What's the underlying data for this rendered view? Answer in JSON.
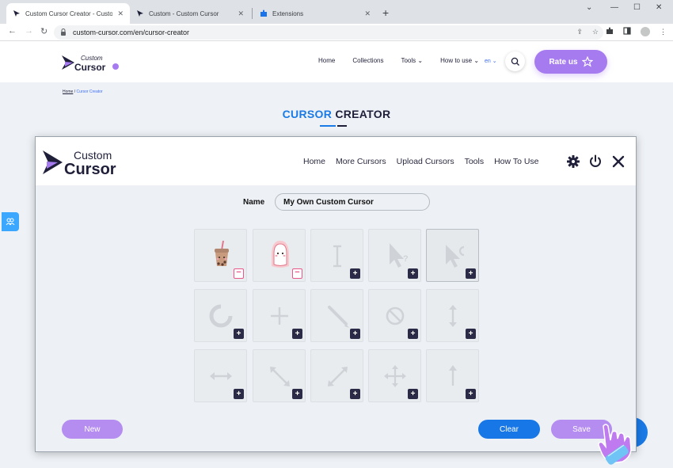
{
  "browser": {
    "tabs": [
      {
        "title": "Custom Cursor Creator - Custom",
        "active": true
      },
      {
        "title": "Custom - Custom Cursor",
        "active": false
      },
      {
        "title": "Extensions",
        "active": false
      }
    ],
    "url": "custom-cursor.com/en/cursor-creator",
    "new_tab": "+",
    "window_controls": [
      "⌄",
      "—",
      "☐",
      "✕"
    ]
  },
  "site": {
    "logo": {
      "line1": "Custom",
      "line2": "Cursor"
    },
    "nav": [
      "Home",
      "Collections",
      "Tools",
      "How to use"
    ],
    "language": "en",
    "rate_button": "Rate us",
    "breadcrumb": {
      "home": "Home",
      "separator": "/",
      "current": "Cursor Creator"
    },
    "title": {
      "accent": "CURSOR",
      "rest": "CREATOR"
    },
    "colors": {
      "accent": "#1a7ae6",
      "purple": "#a67bf0"
    }
  },
  "modal": {
    "logo": {
      "line1": "Custom",
      "line2": "Cursor"
    },
    "nav": [
      "Home",
      "More Cursors",
      "Upload Cursors",
      "Tools",
      "How To Use"
    ],
    "icons": [
      "gear-icon",
      "power-icon",
      "close-icon"
    ],
    "name_label": "Name",
    "name_value": "My Own Custom Cursor",
    "slots": [
      {
        "icon": "boba-tea-cursor",
        "state": "filled"
      },
      {
        "icon": "cute-character-pointer",
        "state": "filled"
      },
      {
        "icon": "text-ibeam-icon",
        "state": "empty"
      },
      {
        "icon": "help-arrow-icon",
        "state": "empty"
      },
      {
        "icon": "busy-arrow-icon",
        "state": "empty",
        "selected": true
      },
      {
        "icon": "loading-ring-icon",
        "state": "empty"
      },
      {
        "icon": "crosshair-icon",
        "state": "empty"
      },
      {
        "icon": "pen-icon",
        "state": "empty"
      },
      {
        "icon": "unavailable-icon",
        "state": "empty"
      },
      {
        "icon": "resize-vertical-icon",
        "state": "empty"
      },
      {
        "icon": "resize-horizontal-icon",
        "state": "empty"
      },
      {
        "icon": "resize-diagonal-nwse-icon",
        "state": "empty"
      },
      {
        "icon": "resize-diagonal-nesw-icon",
        "state": "empty"
      },
      {
        "icon": "move-icon",
        "state": "empty"
      },
      {
        "icon": "alternate-select-icon",
        "state": "empty"
      }
    ],
    "buttons": {
      "new": "New",
      "clear": "Clear",
      "save": "Save"
    }
  }
}
